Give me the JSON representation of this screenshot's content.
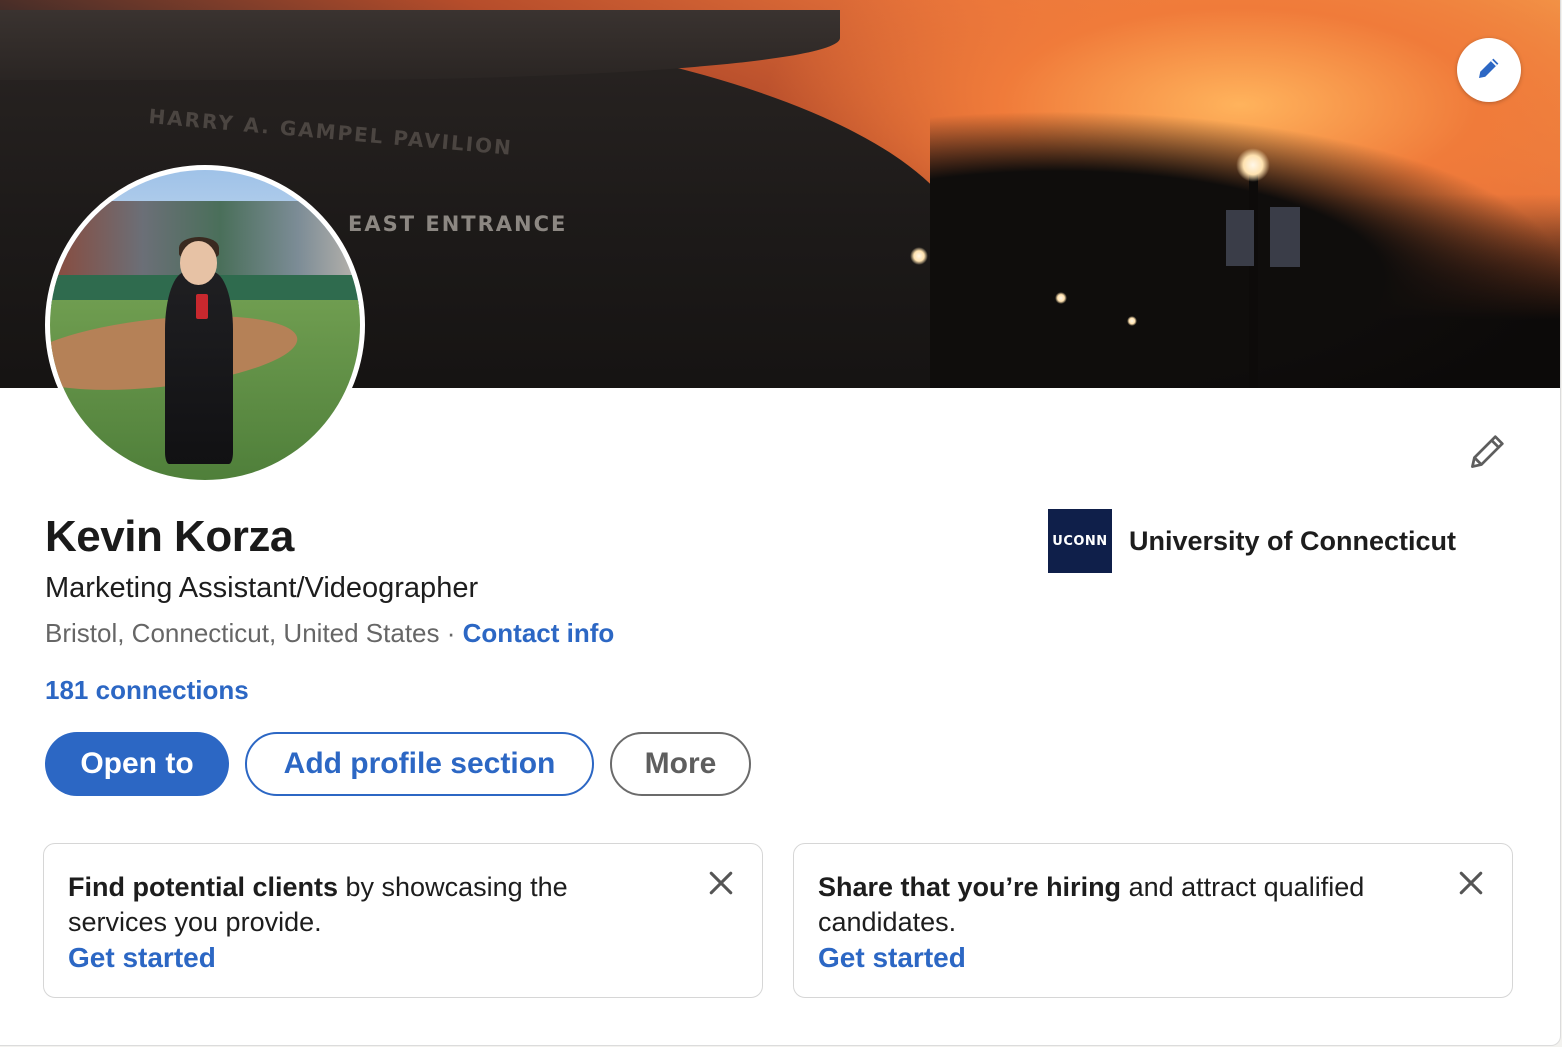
{
  "cover": {
    "edit_icon": "pencil-icon",
    "sign_building": "HARRY A. GAMPEL PAVILION",
    "sign_entrance": "EAST ENTRANCE"
  },
  "intro": {
    "edit_icon": "pencil-icon"
  },
  "profile": {
    "name": "Kevin Korza",
    "headline": "Marketing Assistant/Videographer",
    "location": "Bristol, Connecticut, United States",
    "separator": " · ",
    "contact_info": "Contact info",
    "connections": "181 connections"
  },
  "education": {
    "logo_text": "UCONN",
    "school": "University of Connecticut"
  },
  "actions": {
    "open_to": "Open to",
    "add_section": "Add profile section",
    "more": "More"
  },
  "promos": [
    {
      "bold": "Find potential clients",
      "rest": " by showcasing the services you provide.",
      "link": "Get started"
    },
    {
      "bold": "Share that you’re hiring",
      "rest": " and attract qualified candidates.",
      "link": "Get started"
    }
  ],
  "colors": {
    "accent": "#2c67c4",
    "school_logo_bg": "#0f1f4a"
  }
}
